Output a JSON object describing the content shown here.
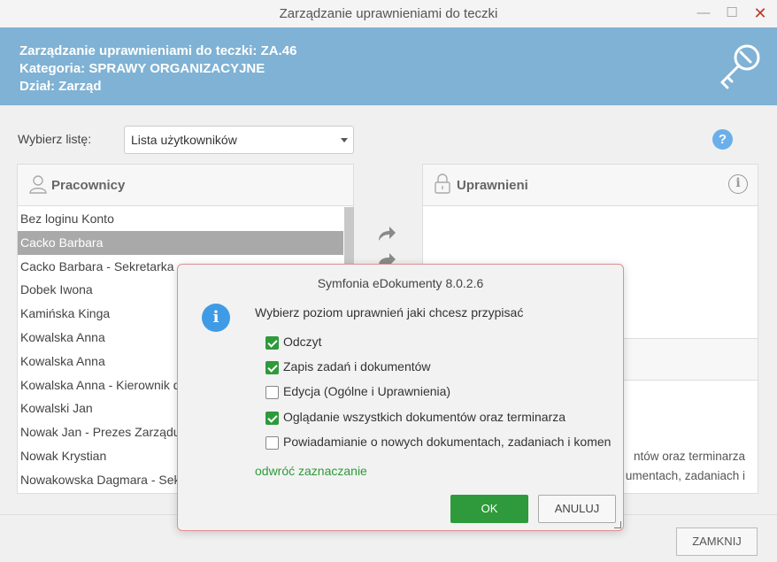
{
  "window": {
    "title": "Zarządzanie uprawnieniami do teczki",
    "min": "—",
    "max": "☐",
    "close": "✕"
  },
  "header": {
    "line1": "Zarządzanie uprawnieniami do teczki: ZA.46",
    "line2": "Kategoria: SPRAWY ORGANIZACYJNE",
    "line3": "Dział: Zarząd"
  },
  "list_selector": {
    "label": "Wybierz listę:",
    "value": "Lista użytkowników"
  },
  "help": {
    "label": "?"
  },
  "left_panel": {
    "title": "Pracownicy",
    "items": [
      "Bez loginu Konto",
      "Cacko Barbara",
      "Cacko Barbara - Sekretarka",
      "Dobek Iwona",
      "Kamińska Kinga",
      "Kowalska Anna",
      "Kowalska Anna",
      "Kowalska Anna - Kierownik d",
      "Kowalski Jan",
      "Nowak Jan - Prezes Zarządu",
      "Nowak Krystian",
      "Nowakowska Dagmara - Sekr"
    ],
    "selected_index": 1
  },
  "right_panel": {
    "title": "Uprawnieni",
    "info": "i",
    "text1": "ntów oraz terminarza",
    "text2": "umentach, zadaniach i"
  },
  "footer": {
    "close_label": "ZAMKNIJ"
  },
  "dialog": {
    "title": "Symfonia eDokumenty 8.0.2.6",
    "icon": "i",
    "prompt": "Wybierz poziom uprawnień jaki chcesz przypisać",
    "options": [
      {
        "label": "Odczyt",
        "checked": true
      },
      {
        "label": "Zapis zadań i dokumentów",
        "checked": true
      },
      {
        "label": "Edycja (Ogólne i Uprawnienia)",
        "checked": false
      },
      {
        "label": "Oglądanie wszystkich dokumentów oraz terminarza",
        "checked": true
      },
      {
        "label": "Powiadamianie o nowych dokumentach, zadaniach i komen",
        "checked": false
      }
    ],
    "invert_link": "odwróć zaznaczanie",
    "ok_label": "OK",
    "cancel_label": "ANULUJ"
  },
  "colors": {
    "header_bg": "#7fb2d4",
    "accent_green": "#2e9a3b",
    "info_blue": "#3f9be6"
  }
}
